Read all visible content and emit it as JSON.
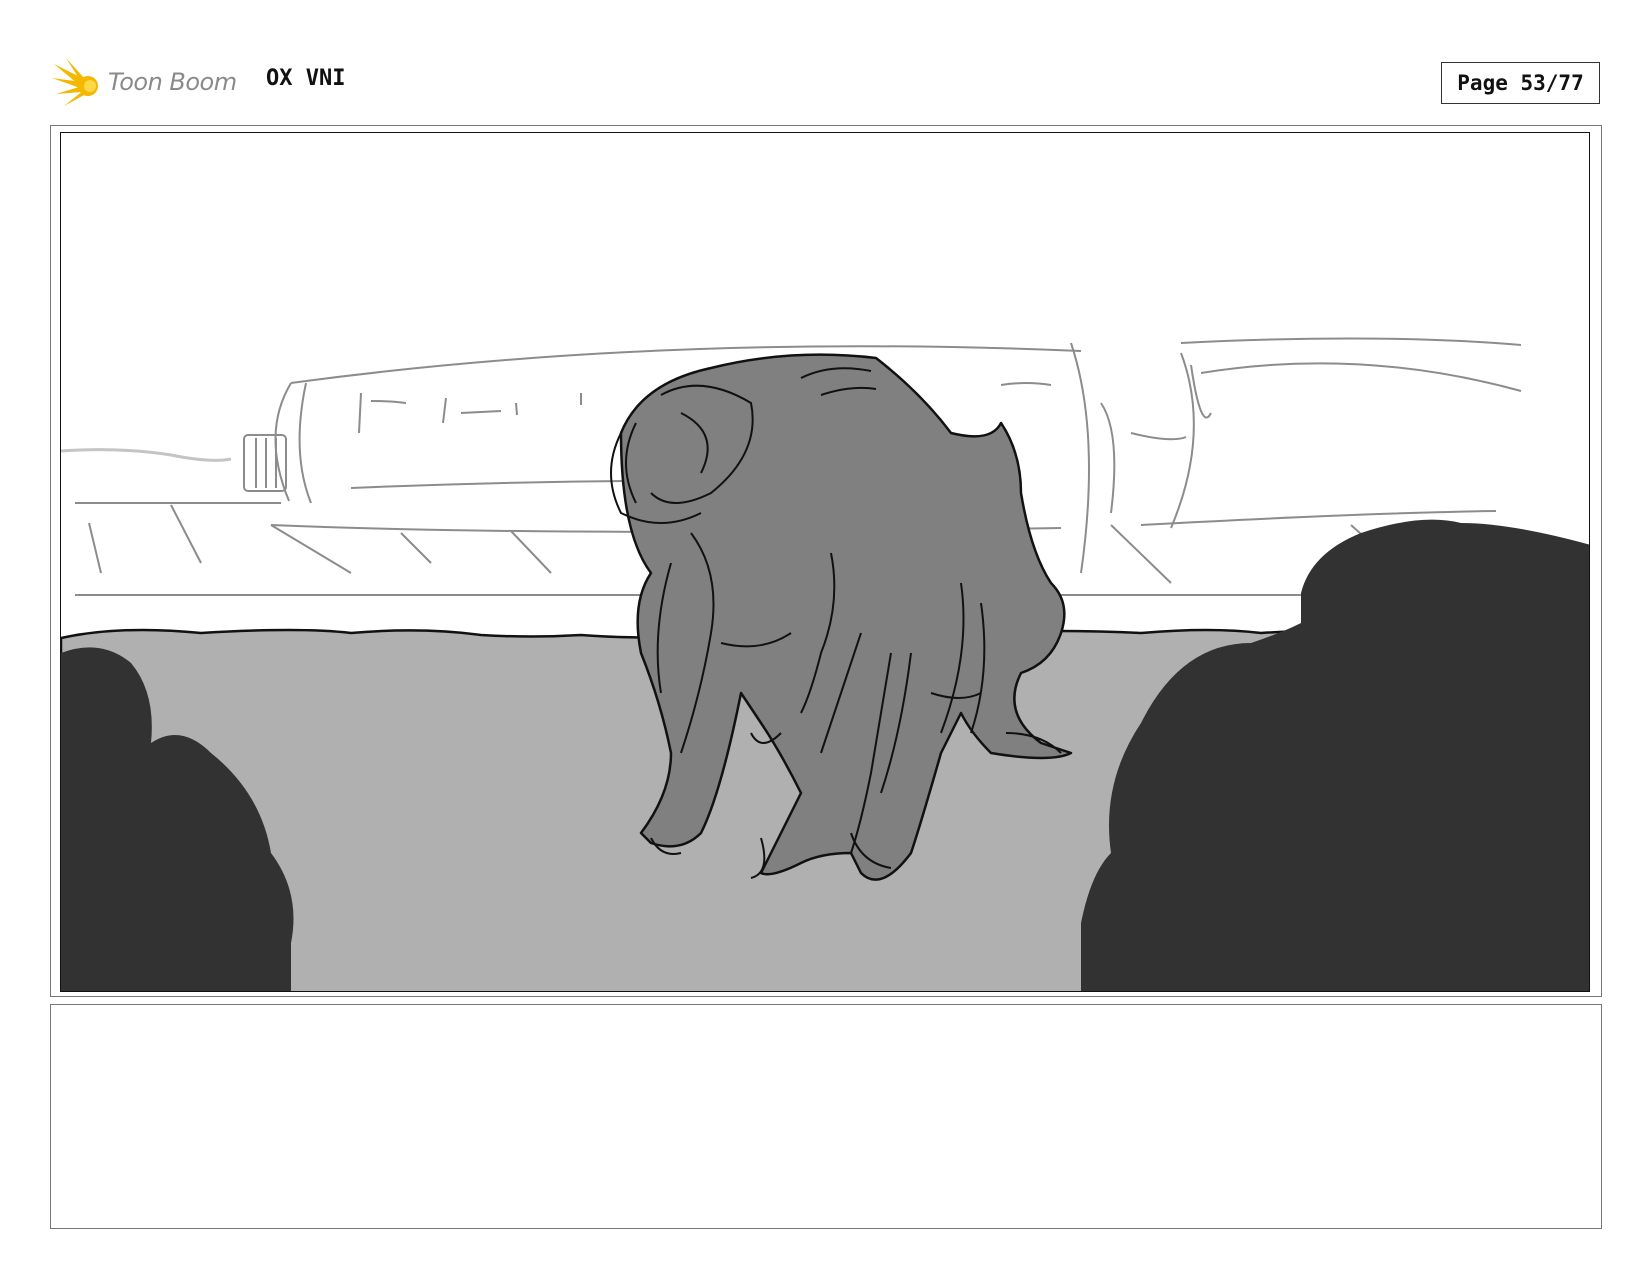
{
  "header": {
    "logo_text": "Toon Boom",
    "project": "OX VNI",
    "page": "Page 53/77"
  },
  "panel": {
    "icon": "storyboard-sketch"
  },
  "notes": {
    "text": ""
  },
  "colors": {
    "logo_yellow": "#f5b800",
    "ground": "#b0b0b0",
    "creature": "#808080",
    "bushes": "#323232"
  }
}
